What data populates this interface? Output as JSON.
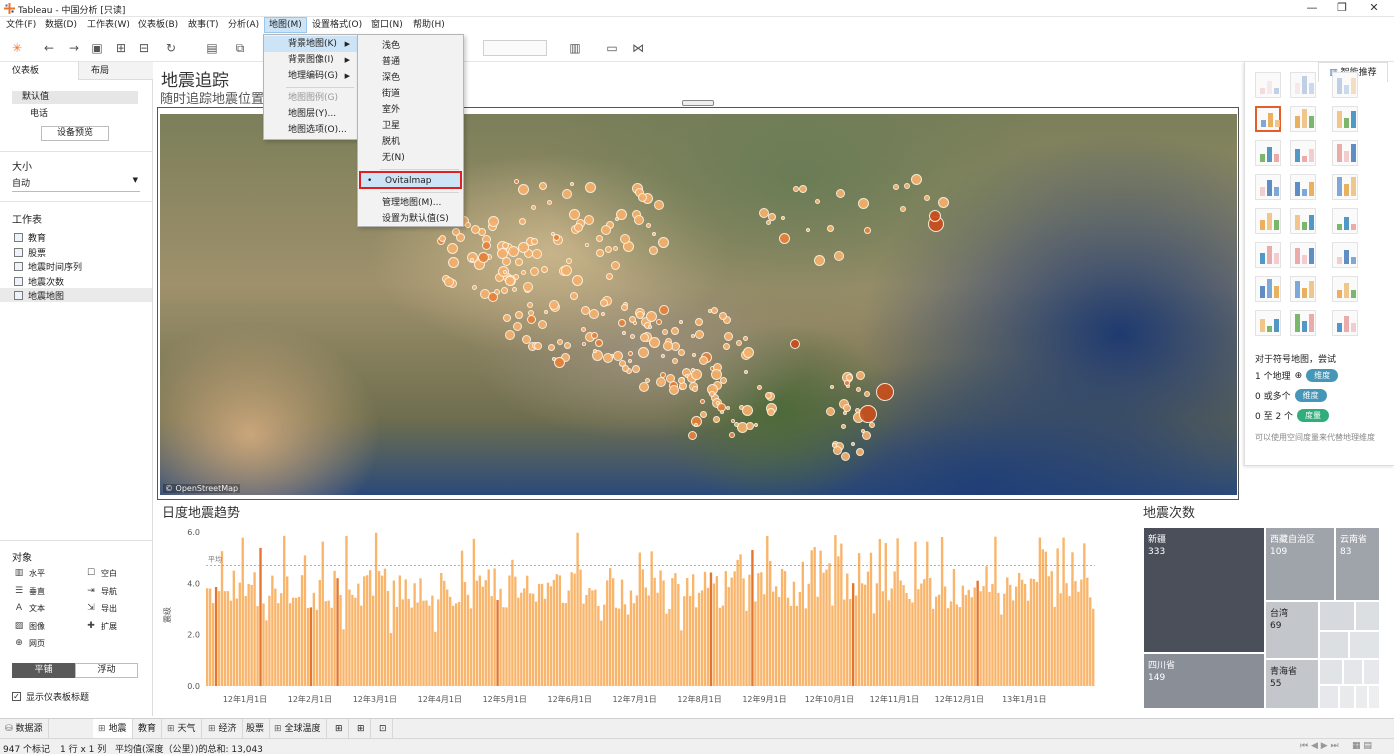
{
  "window": {
    "title": "Tableau - 中国分析 [只读]",
    "minimize": "—",
    "maximize": "❐",
    "close": "✕"
  },
  "menubar": [
    "文件(F)",
    "数据(D)",
    "工作表(W)",
    "仪表板(B)",
    "故事(T)",
    "分析(A)",
    "地图(M)",
    "设置格式(O)",
    "窗口(N)",
    "帮助(H)"
  ],
  "left_panel": {
    "tab_dashboard": "仪表板",
    "tab_layout": "布局",
    "device_default": "默认值",
    "device_phone": "电话",
    "device_preview_button": "设备预览",
    "size_label": "大小",
    "size_value": "自动",
    "sheets_label": "工作表",
    "sheets": [
      "教育",
      "股票",
      "地震时间序列",
      "地震次数",
      "地震地图"
    ],
    "objects_label": "对象",
    "objects": [
      {
        "icon": "▥",
        "label": "水平"
      },
      {
        "icon": "☐",
        "label": "空白"
      },
      {
        "icon": "☰",
        "label": "垂直"
      },
      {
        "icon": "⇥",
        "label": "导航"
      },
      {
        "icon": "A",
        "label": "文本"
      },
      {
        "icon": "⇲",
        "label": "导出"
      },
      {
        "icon": "▨",
        "label": "图像"
      },
      {
        "icon": "✚",
        "label": "扩展"
      },
      {
        "icon": "⊕",
        "label": "网页"
      }
    ],
    "tiled": "平铺",
    "floating": "浮动",
    "show_title_checkbox": "显示仪表板标题"
  },
  "dashboard": {
    "title": "地震追踪",
    "subtitle": "随时追踪地震位置",
    "map_credit": "© OpenStreetMap"
  },
  "map_menu": {
    "items": [
      "背景地图(K)",
      "背景图像(I)",
      "地理编码(G)",
      "地图图例(G)",
      "地图层(Y)...",
      "地图选项(O)..."
    ]
  },
  "background_map_submenu": {
    "items": [
      "浅色",
      "普通",
      "深色",
      "街道",
      "室外",
      "卫星",
      "脱机",
      "无(N)"
    ],
    "selected": "Ovitalmap",
    "manage": "管理地图(M)...",
    "set_default": "设置为默认值(S)"
  },
  "trend_chart_title": "日度地震趋势",
  "chart_data": [
    {
      "type": "bar",
      "title": "日度地震趋势",
      "ylabel": "震级",
      "ylim": [
        0,
        6.0
      ],
      "yticks": [
        "0.0",
        "2.0",
        "4.0",
        "6.0"
      ],
      "xticks": [
        "12年1月1日",
        "12年2月1日",
        "12年3月1日",
        "12年4月1日",
        "12年5月1日",
        "12年6月1日",
        "12年7月1日",
        "12年8月1日",
        "12年9月1日",
        "12年10月1日",
        "12年11月1日",
        "12年12月1日",
        "13年1月1日"
      ],
      "reference_line": {
        "label": "平均",
        "value": 4.7
      },
      "color": "#f8b56b",
      "highlight_color": "#e3762c"
    },
    {
      "type": "treemap",
      "title": "地震次数",
      "cells": [
        {
          "name": "新疆",
          "value": 333,
          "color": "#4a4f5a"
        },
        {
          "name": "西藏自治区",
          "value": 109,
          "color": "#9fa4ab"
        },
        {
          "name": "云南省",
          "value": 83,
          "color": "#9fa4ab"
        },
        {
          "name": "四川省",
          "value": 149,
          "color": "#8a8f97"
        },
        {
          "name": "台湾",
          "value": 69,
          "color": "#c3c7cc"
        },
        {
          "name": "青海省",
          "value": 55,
          "color": "#c3c7cc"
        }
      ]
    }
  ],
  "right_panel": {
    "tab": "智能推荐",
    "hint_title": "对于符号地图，尝试",
    "req1_prefix": "1 个地理",
    "req1_pill": "维度",
    "req2_prefix": "0 或多个",
    "req2_pill": "维度",
    "req3_prefix": "0 至 2 个",
    "req3_pill": "度量",
    "note": "可以使用空间度量来代替地理维度",
    "colors": {
      "dimension": "#4596b7",
      "measure": "#2fae7c"
    }
  },
  "bottom_tabs": [
    "数据源",
    "地震",
    "教育",
    "天气",
    "经济",
    "股票",
    "全球温度"
  ],
  "status": {
    "marks": "947 个标记",
    "rows_cols": "1 行 x 1 列",
    "sum": "平均值(深度（公里）)的总和: 13,043"
  }
}
